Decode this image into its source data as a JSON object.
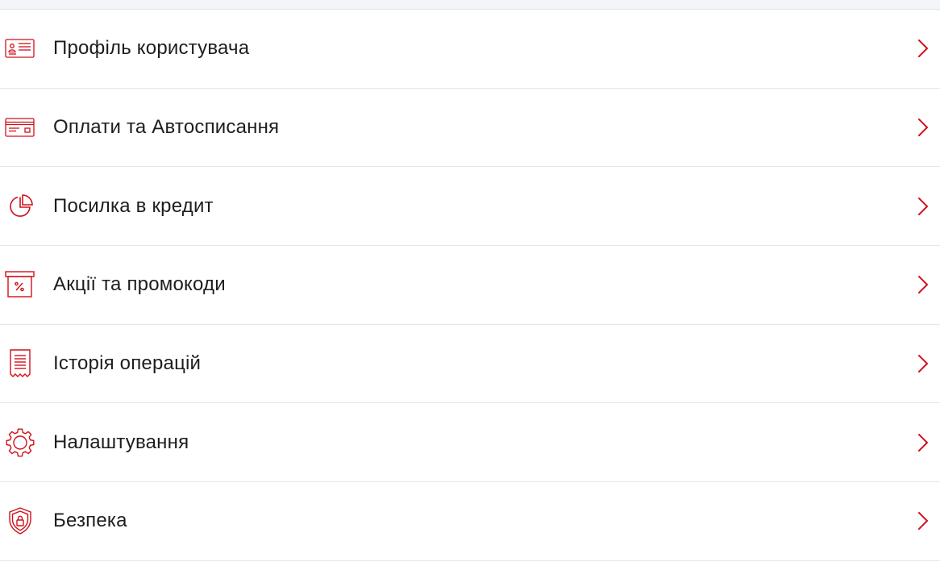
{
  "colors": {
    "accent": "#d0101b",
    "text": "#1d1d1f",
    "divider": "#e6e6e6",
    "header_bg": "#f3f5f8"
  },
  "menu": {
    "items": [
      {
        "label": "Профіль користувача",
        "icon": "id-card-icon"
      },
      {
        "label": "Оплати та Автосписання",
        "icon": "credit-card-icon"
      },
      {
        "label": "Посилка в кредит",
        "icon": "pie-chart-icon"
      },
      {
        "label": "Акції та промокоди",
        "icon": "percent-box-icon"
      },
      {
        "label": "Історія операцій",
        "icon": "receipt-icon"
      },
      {
        "label": "Налаштування",
        "icon": "gear-icon"
      },
      {
        "label": "Безпека",
        "icon": "shield-lock-icon"
      }
    ]
  }
}
